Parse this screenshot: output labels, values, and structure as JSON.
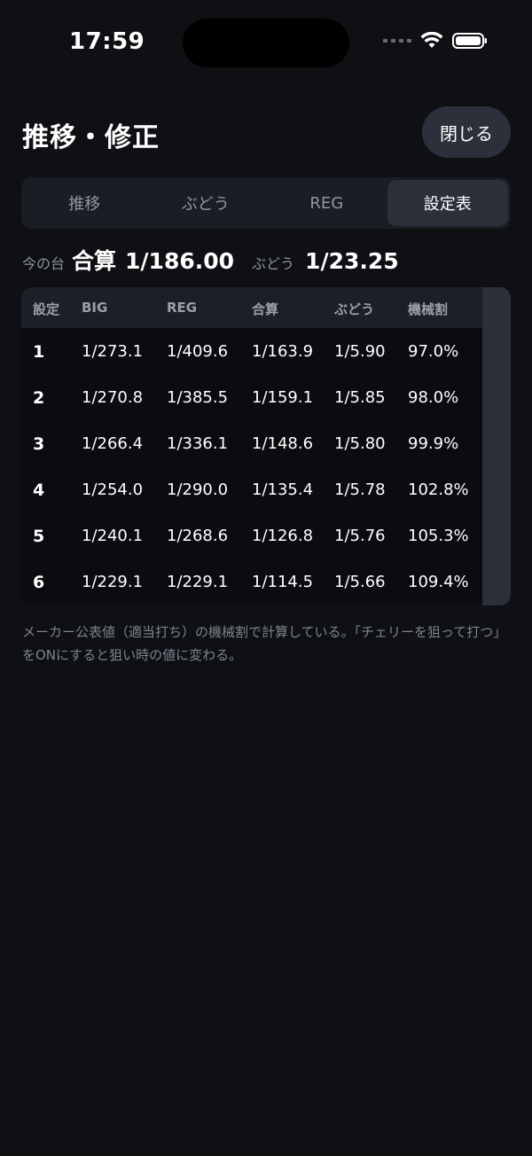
{
  "status_bar": {
    "time": "17:59"
  },
  "header": {
    "title": "推移・修正",
    "close_label": "閉じる"
  },
  "tabs": [
    {
      "label": "推移",
      "active": false
    },
    {
      "label": "ぶどう",
      "active": false
    },
    {
      "label": "REG",
      "active": false
    },
    {
      "label": "設定表",
      "active": true
    }
  ],
  "summary": {
    "current_label": "今の台",
    "total_label": "合算",
    "total_value": "1/186.00",
    "grape_label": "ぶどう",
    "grape_value": "1/23.25"
  },
  "table": {
    "columns": [
      "設定",
      "BIG",
      "REG",
      "合算",
      "ぶどう",
      "機械割"
    ],
    "rows": [
      [
        "1",
        "1/273.1",
        "1/409.6",
        "1/163.9",
        "1/5.90",
        "97.0%"
      ],
      [
        "2",
        "1/270.8",
        "1/385.5",
        "1/159.1",
        "1/5.85",
        "98.0%"
      ],
      [
        "3",
        "1/266.4",
        "1/336.1",
        "1/148.6",
        "1/5.80",
        "99.9%"
      ],
      [
        "4",
        "1/254.0",
        "1/290.0",
        "1/135.4",
        "1/5.78",
        "102.8%"
      ],
      [
        "5",
        "1/240.1",
        "1/268.6",
        "1/126.8",
        "1/5.76",
        "105.3%"
      ],
      [
        "6",
        "1/229.1",
        "1/229.1",
        "1/114.5",
        "1/5.66",
        "109.4%"
      ]
    ]
  },
  "note": "メーカー公表値（適当打ち）の機械割で計算している。「チェリーを狙って打つ」をONにすると狙い時の値に変わる。"
}
